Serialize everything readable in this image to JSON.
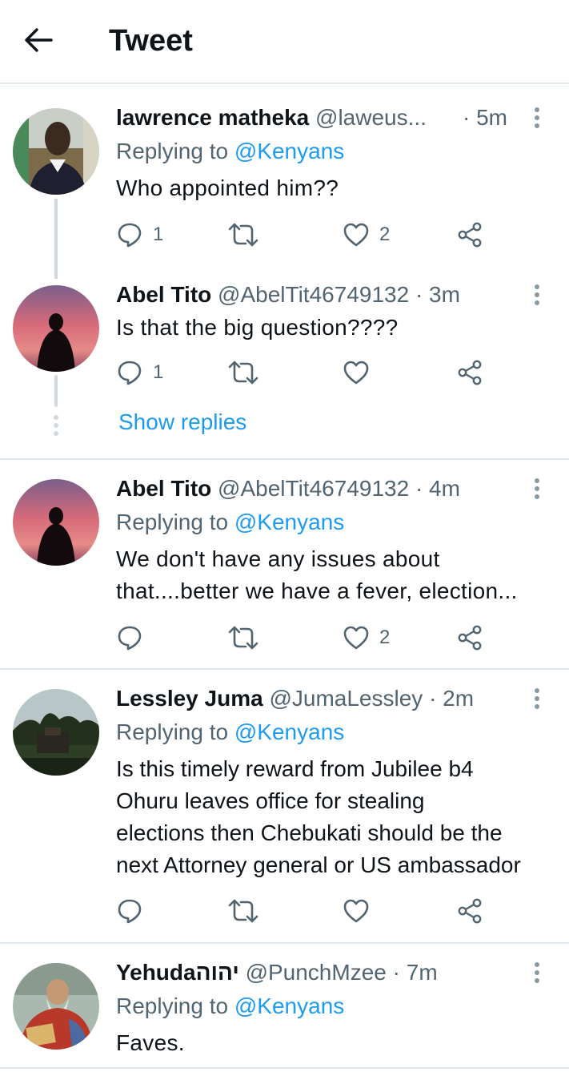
{
  "header": {
    "title": "Tweet",
    "back_icon": "arrow-left-icon"
  },
  "colors": {
    "accent": "#1d9bf0",
    "secondary_text": "#536471",
    "divider": "#e1e8ed"
  },
  "tweets": [
    {
      "name": "lawrence matheka",
      "handle": "@laweus...",
      "time": "· 5m",
      "replying_prefix": "Replying to",
      "replying_to": "@Kenyans",
      "text": "Who appointed him??",
      "reply_count": "1",
      "retweet_count": "",
      "like_count": "2"
    },
    {
      "name": "Abel Tito",
      "handle": "@AbelTit46749132",
      "time": "· 3m",
      "text": "Is that the big question????",
      "reply_count": "1",
      "retweet_count": "",
      "like_count": "",
      "show_replies": "Show replies"
    },
    {
      "name": "Abel Tito",
      "handle": "@AbelTit46749132",
      "time": "· 4m",
      "replying_prefix": "Replying to",
      "replying_to": "@Kenyans",
      "text_line1": "We don't have any issues about",
      "text_line2": "that....better we have a fever, election...",
      "reply_count": "",
      "retweet_count": "",
      "like_count": "2"
    },
    {
      "name": "Lessley Juma",
      "handle": "@JumaLessley",
      "time": "· 2m",
      "replying_prefix": "Replying to",
      "replying_to": "@Kenyans",
      "text_line1": "Is this timely reward from Jubilee b4",
      "text_line2": "Ohuru leaves office for stealing",
      "text_line3": "elections then Chebukati should be the",
      "text_line4": "next Attorney general or US ambassador",
      "reply_count": "",
      "retweet_count": "",
      "like_count": ""
    },
    {
      "name": "Yehudaיהוה",
      "handle": "@PunchMzee",
      "time": "· 7m",
      "replying_prefix": "Replying to",
      "replying_to": "@Kenyans",
      "text": "Faves."
    }
  ]
}
